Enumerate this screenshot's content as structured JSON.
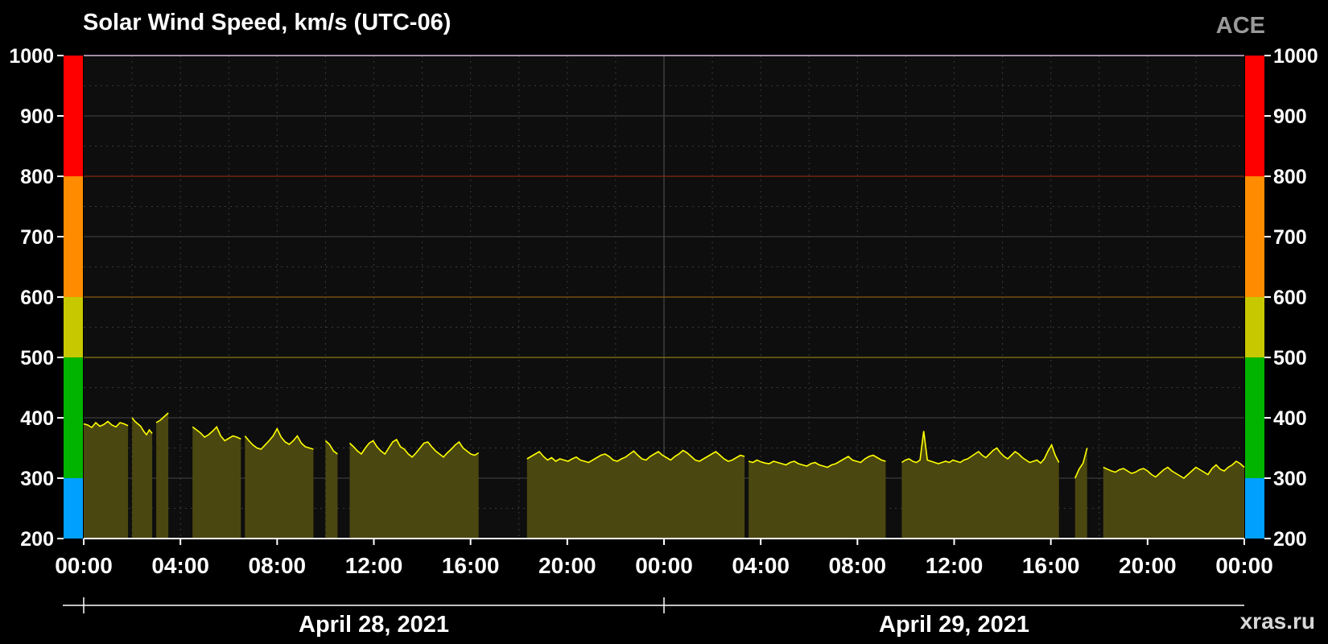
{
  "header": {
    "title": "Solar Wind Speed, km/s (UTC-06)",
    "source": "ACE",
    "watermark": "xras.ru"
  },
  "colors": {
    "background": "#000000",
    "plot_background": "#0e0e0e",
    "data_line": "#ffff00",
    "data_fill": "#4b4710",
    "band_blue": "#00a0ff",
    "band_green": "#00b400",
    "band_yellow": "#c8c800",
    "band_orange": "#ff8c00",
    "band_red": "#ff0000"
  },
  "chart_data": {
    "type": "area",
    "title": "Solar Wind Speed, km/s (UTC-06)",
    "xlabel": "",
    "ylabel": "",
    "ylim": [
      200,
      1000
    ],
    "xlim": [
      "2021-04-28 00:00",
      "2021-04-30 00:00"
    ],
    "y_ticks": [
      200,
      300,
      400,
      500,
      600,
      700,
      800,
      900,
      1000
    ],
    "x_tick_labels": [
      "00:00",
      "04:00",
      "08:00",
      "12:00",
      "16:00",
      "20:00",
      "00:00",
      "04:00",
      "08:00",
      "12:00",
      "16:00",
      "20:00",
      "00:00"
    ],
    "date_labels": [
      "April 28, 2021",
      "April 29, 2021"
    ],
    "grid": true,
    "legend": "none",
    "scale_bands": [
      {
        "from": 200,
        "to": 300,
        "color": "#00a0ff"
      },
      {
        "from": 300,
        "to": 500,
        "color": "#00b400"
      },
      {
        "from": 500,
        "to": 600,
        "color": "#c8c800"
      },
      {
        "from": 600,
        "to": 800,
        "color": "#ff8c00"
      },
      {
        "from": 800,
        "to": 1000,
        "color": "#ff0000"
      }
    ],
    "threshold_lines": [
      {
        "value": 500,
        "color": "#8a7a10"
      },
      {
        "value": 600,
        "color": "#8a5a10"
      },
      {
        "value": 800,
        "color": "#8a2a10"
      }
    ],
    "series": [
      {
        "segments": [
          {
            "start": "2021-04-28 00:00",
            "end": "2021-04-28 01:50",
            "values": [
              390,
              388,
              384,
              392,
              386,
              389,
              394,
              388,
              385,
              392,
              390,
              387
            ]
          },
          {
            "start": "2021-04-28 02:00",
            "end": "2021-04-28 02:50",
            "values": [
              400,
              394,
              390,
              386,
              378,
              372,
              380,
              374
            ]
          },
          {
            "start": "2021-04-28 03:00",
            "end": "2021-04-28 03:30",
            "values": [
              392,
              396,
              402,
              408
            ]
          },
          {
            "start": "2021-04-28 04:30",
            "end": "2021-04-28 06:30",
            "values": [
              385,
              380,
              375,
              368,
              372,
              378,
              385,
              370,
              362,
              366,
              370,
              368,
              365
            ]
          },
          {
            "start": "2021-04-28 06:40",
            "end": "2021-04-28 09:30",
            "values": [
              370,
              362,
              355,
              350,
              348,
              355,
              362,
              370,
              382,
              368,
              360,
              356,
              362,
              370,
              358,
              352,
              350,
              348
            ]
          },
          {
            "start": "2021-04-28 10:00",
            "end": "2021-04-28 10:30",
            "values": [
              362,
              356,
              345,
              340
            ]
          },
          {
            "start": "2021-04-28 11:00",
            "end": "2021-04-28 16:20",
            "values": [
              358,
              352,
              345,
              340,
              350,
              358,
              362,
              352,
              345,
              340,
              350,
              360,
              364,
              352,
              348,
              340,
              335,
              342,
              350,
              358,
              360,
              352,
              345,
              340,
              335,
              342,
              348,
              355,
              360,
              350,
              345,
              340,
              338,
              342
            ]
          },
          {
            "start": "2021-04-28 18:20",
            "end": "2021-04-29 03:20",
            "values": [
              332,
              336,
              340,
              344,
              336,
              330,
              334,
              328,
              332,
              330,
              328,
              332,
              335,
              330,
              328,
              326,
              330,
              334,
              338,
              340,
              336,
              330,
              328,
              332,
              335,
              340,
              345,
              338,
              332,
              330,
              336,
              340,
              344,
              338,
              334,
              330,
              336,
              340,
              346,
              342,
              336,
              330,
              328,
              332,
              336,
              340,
              344,
              338,
              332,
              328,
              330,
              334,
              338,
              336
            ]
          },
          {
            "start": "2021-04-29 03:30",
            "end": "2021-04-29 09:10",
            "values": [
              328,
              326,
              330,
              327,
              325,
              324,
              328,
              326,
              324,
              322,
              326,
              328,
              324,
              322,
              320,
              324,
              326,
              322,
              320,
              318,
              322,
              324,
              328,
              332,
              336,
              330,
              328,
              326,
              332,
              336,
              338,
              334,
              330,
              328
            ]
          },
          {
            "start": "2021-04-29 09:50",
            "end": "2021-04-29 16:20",
            "values": [
              326,
              330,
              332,
              328,
              326,
              330,
              378,
              330,
              328,
              326,
              324,
              326,
              328,
              326,
              330,
              328,
              326,
              330,
              332,
              336,
              340,
              344,
              338,
              334,
              340,
              346,
              350,
              342,
              336,
              332,
              338,
              344,
              340,
              334,
              330,
              326,
              328,
              330,
              325,
              332,
              345,
              355,
              338,
              326
            ]
          },
          {
            "start": "2021-04-29 17:00",
            "end": "2021-04-29 17:30",
            "values": [
              300,
              315,
              325,
              350
            ]
          },
          {
            "start": "2021-04-29 18:10",
            "end": "2021-04-30 00:00",
            "values": [
              318,
              315,
              312,
              310,
              314,
              316,
              312,
              308,
              310,
              314,
              316,
              312,
              306,
              302,
              308,
              314,
              318,
              312,
              308,
              304,
              300,
              306,
              312,
              318,
              314,
              310,
              306,
              316,
              322,
              315,
              312,
              318,
              322,
              328,
              324,
              318
            ]
          }
        ]
      }
    ]
  }
}
